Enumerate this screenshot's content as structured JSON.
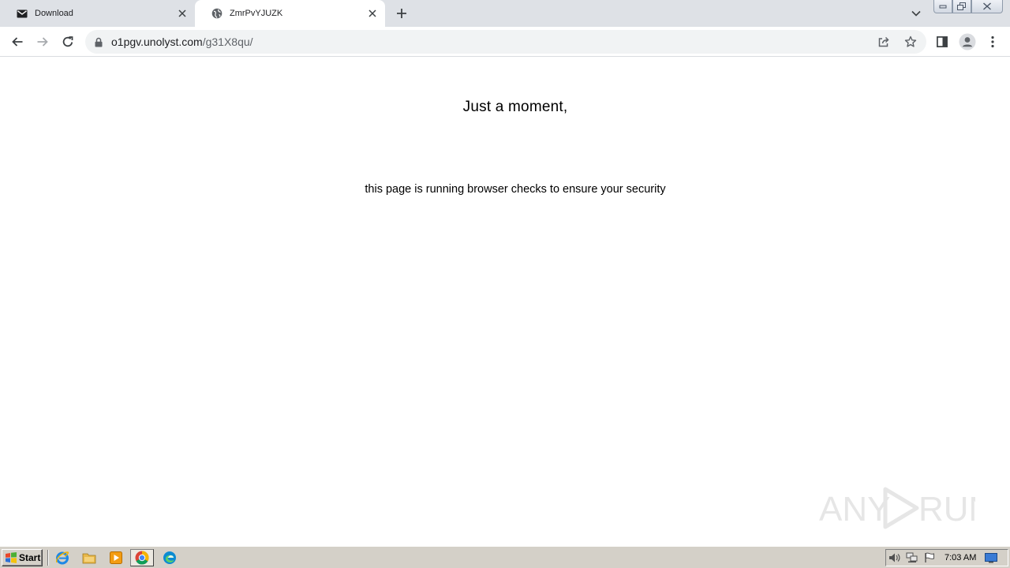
{
  "browser": {
    "tabs": [
      {
        "title": "Download",
        "favicon": "mail-icon",
        "active": false
      },
      {
        "title": "ZmrPvYJUZK",
        "favicon": "globe-icon",
        "active": true
      }
    ],
    "address": {
      "host": "o1pgv.unolyst.com",
      "path": "/g31X8qu/"
    }
  },
  "page": {
    "heading": "Just a moment,",
    "message": "this page is running browser checks to ensure your security"
  },
  "watermark": {
    "text": "ANY RUN"
  },
  "taskbar": {
    "start_label": "Start",
    "apps": [
      "internet-explorer-icon",
      "file-explorer-icon",
      "media-player-icon",
      "chrome-icon",
      "edge-icon"
    ],
    "clock": "7:03 AM"
  }
}
